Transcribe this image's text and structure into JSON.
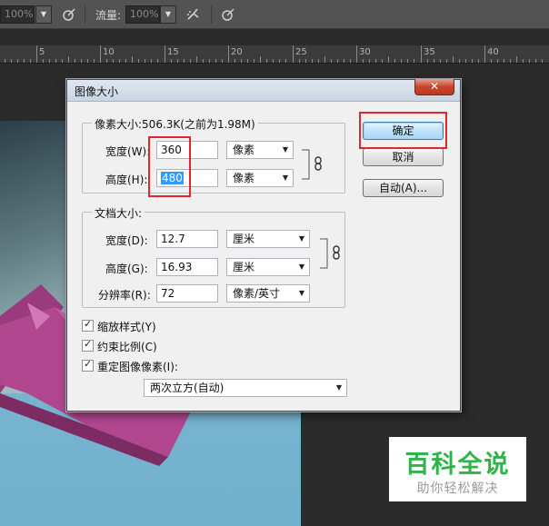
{
  "options_bar": {
    "opacity_value": "100%",
    "flow_label": "流量:",
    "flow_value": "100%"
  },
  "ruler": {
    "ticks": [
      "5",
      "10",
      "15",
      "20",
      "25",
      "30",
      "35",
      "40"
    ]
  },
  "dialog": {
    "title": "图像大小",
    "close_symbol": "✕",
    "pixel_dimensions": {
      "legend": "像素大小:506.3K(之前为1.98M)",
      "width_label": "宽度(W):",
      "width_value": "360",
      "width_unit": "像素",
      "height_label": "高度(H):",
      "height_value": "480",
      "height_unit": "像素"
    },
    "document_size": {
      "legend": "文档大小:",
      "width_label": "宽度(D):",
      "width_value": "12.7",
      "width_unit": "厘米",
      "height_label": "高度(G):",
      "height_value": "16.93",
      "height_unit": "厘米",
      "resolution_label": "分辨率(R):",
      "resolution_value": "72",
      "resolution_unit": "像素/英寸"
    },
    "options": {
      "scale_styles": "缩放样式(Y)",
      "constrain_proportions": "约束比例(C)",
      "resample_image": "重定图像像素(I):",
      "resample_method": "两次立方(自动)",
      "check_mark": "✓"
    },
    "buttons": {
      "ok": "确定",
      "cancel": "取消",
      "auto": "自动(A)..."
    }
  },
  "watermark": {
    "title": "百科全说",
    "subtitle": "助你轻松解决"
  },
  "colors": {
    "highlight_border": "#e0262e",
    "selection": "#3399ff",
    "watermark_green": "#2fb449"
  }
}
